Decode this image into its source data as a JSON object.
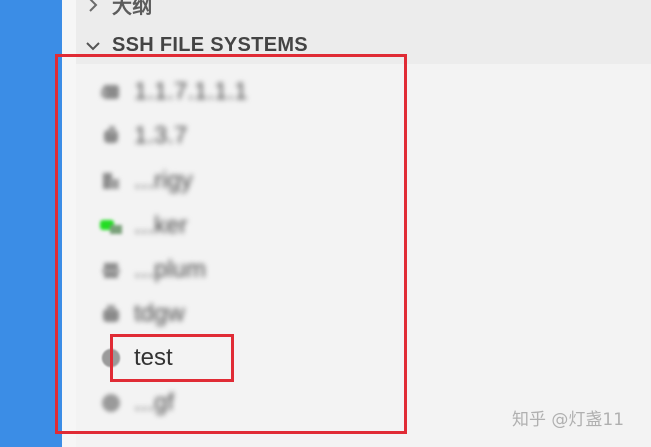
{
  "activity_bar": {
    "color": "#3b8de6"
  },
  "sections": {
    "previous_label": "大纲",
    "ssh_label": "SSH FILE SYSTEMS"
  },
  "hosts": [
    {
      "label": "1.1.7.1.1.1",
      "icon": "server-icon",
      "blurred": true
    },
    {
      "label": "1.3.7",
      "icon": "server-icon",
      "blurred": true
    },
    {
      "label": "...rigy",
      "icon": "server-icon",
      "blurred": true
    },
    {
      "label": "...ker",
      "icon": "server-icon",
      "blurred": true
    },
    {
      "label": "...plum",
      "icon": "server-icon",
      "blurred": true
    },
    {
      "label": "tdgw",
      "icon": "server-icon",
      "blurred": true
    },
    {
      "label": "test",
      "icon": "server-icon",
      "blurred": false
    },
    {
      "label": "...gf",
      "icon": "server-icon",
      "blurred": true
    }
  ],
  "watermark": "知乎 @灯盏11",
  "colors": {
    "highlight": "#e02b35",
    "active_indicator": "#22dd22"
  }
}
